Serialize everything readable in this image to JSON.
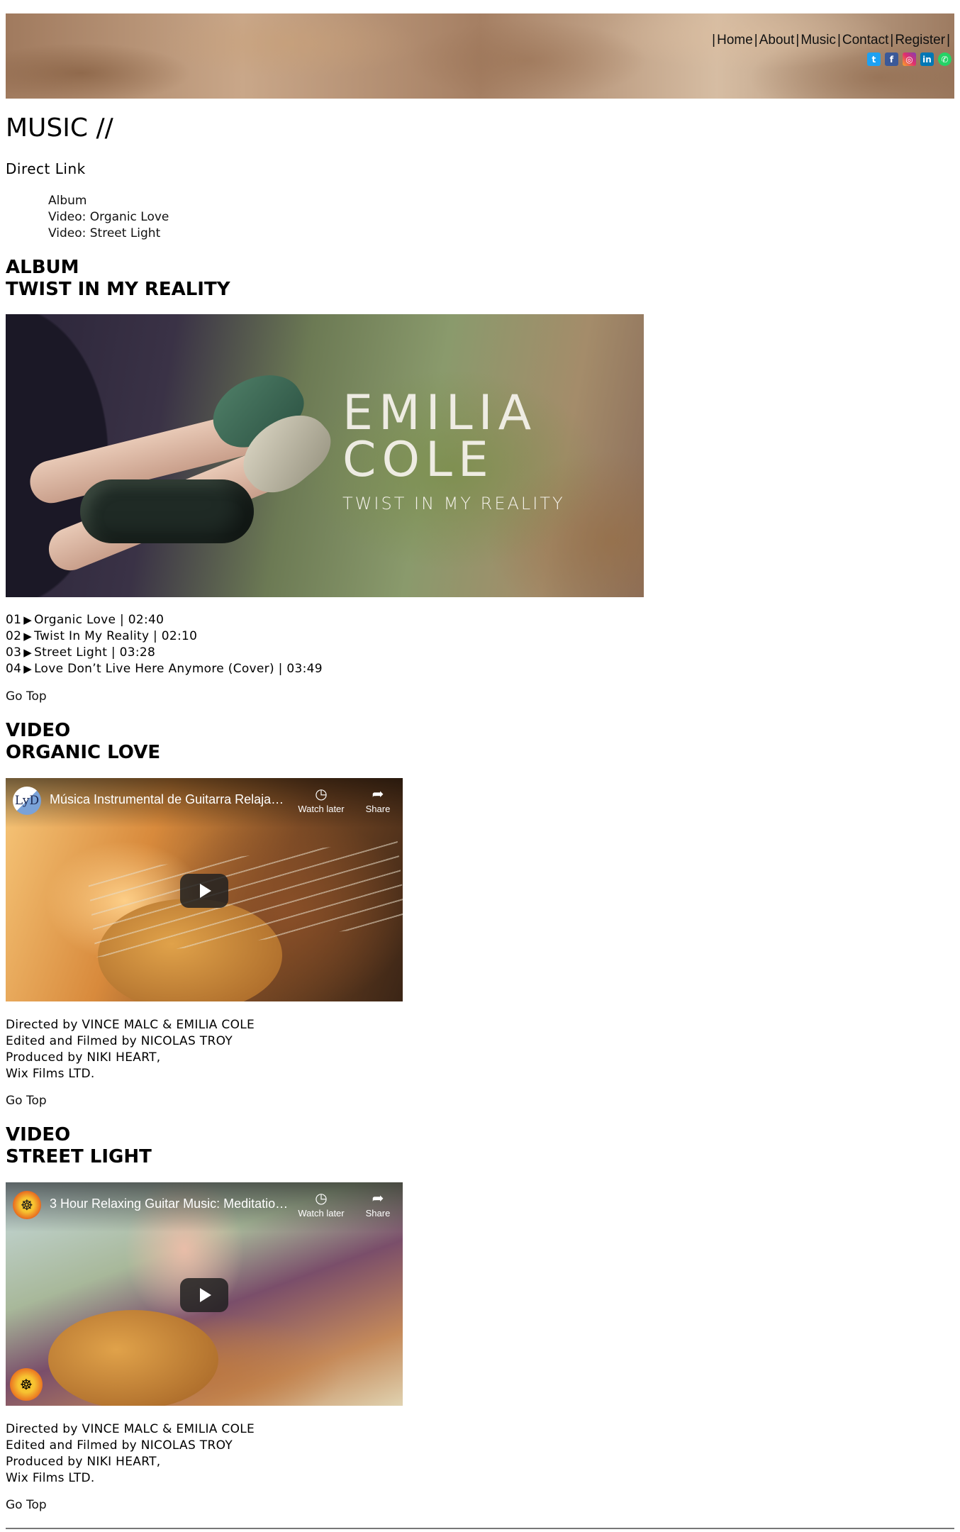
{
  "header": {
    "nav": [
      {
        "label": "Home"
      },
      {
        "label": "About"
      },
      {
        "label": "Music"
      },
      {
        "label": "Contact"
      },
      {
        "label": "Register"
      }
    ],
    "separator": "|",
    "social_icons": [
      "twitter-icon",
      "facebook-icon",
      "instagram-icon",
      "linkedin-icon",
      "whatsapp-icon"
    ]
  },
  "page_title": "MUSIC //",
  "direct_link": {
    "title": "Direct Link",
    "links": [
      {
        "label": "Album"
      },
      {
        "label": "Video: Organic Love"
      },
      {
        "label": "Video: Street Light"
      }
    ]
  },
  "album": {
    "heading_line1": "ALBUM",
    "heading_line2": "TWIST IN MY REALITY",
    "art_artist_line1": "EMILIA",
    "art_artist_line2": "COLE",
    "art_record": "TWIST IN MY REALITY",
    "tracks": [
      {
        "num": "01",
        "title": "Organic Love | 02:40"
      },
      {
        "num": "02",
        "title": "Twist In My Reality | 02:10"
      },
      {
        "num": "03",
        "title": "Street Light | 03:28"
      },
      {
        "num": "04",
        "title": "Love Don’t Live Here Anymore (Cover) | 03:49"
      }
    ],
    "go_top": "Go Top"
  },
  "video1": {
    "heading_line1": "VIDEO",
    "heading_line2": "ORGANIC LOVE",
    "channel_logo_text": "LyD",
    "title": "Música Instrumental de Guitarra Relajante...",
    "watch_later": "Watch later",
    "share": "Share",
    "credits": [
      "Directed by VINCE MALC & EMILIA COLE",
      "Edited and Filmed by NICOLAS TROY",
      "Produced by NIKI HEART,",
      "Wix Films LTD."
    ],
    "go_top": "Go Top"
  },
  "video2": {
    "heading_line1": "VIDEO",
    "heading_line2": "STREET LIGHT",
    "title": "3 Hour Relaxing Guitar Music: Meditation...",
    "watch_later": "Watch later",
    "share": "Share",
    "credits": [
      "Directed by VINCE MALC & EMILIA COLE",
      "Edited and Filmed by NICOLAS TROY",
      "Produced by NIKI HEART,",
      "Wix Films LTD."
    ],
    "go_top": "Go Top"
  }
}
